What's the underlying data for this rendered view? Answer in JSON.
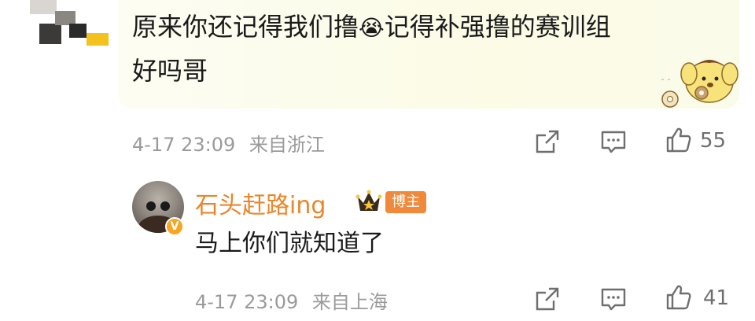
{
  "comment": {
    "text_line1_part1": "原来你还记得我们撸",
    "emoji": "😭",
    "text_line1_part2": "记得补强撸的赛训组",
    "text_line2": "好吗哥",
    "timestamp": "4-17 23:09",
    "location": "来自浙江",
    "like_count": "55"
  },
  "reply": {
    "username": "石头赶路ing",
    "badge": "博主",
    "text": "马上你们就知道了",
    "timestamp": "4-17 23:09",
    "location": "来自上海",
    "like_count": "41"
  },
  "icons": [
    "share-icon",
    "comment-icon",
    "like-icon",
    "crown-icon",
    "verified-icon"
  ],
  "colors": {
    "username": "#e8862a",
    "badge_bg": "#f08a3a",
    "meta_text": "#9a9a9a",
    "verified": "#f5a623"
  }
}
